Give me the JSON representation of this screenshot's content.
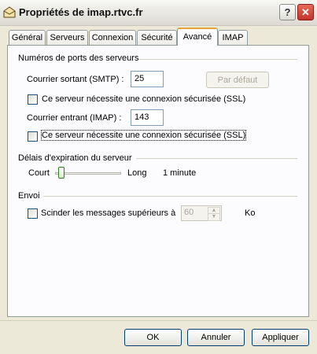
{
  "window": {
    "title": "Propriétés de imap.rtvc.fr",
    "icon": "mail-server-icon"
  },
  "title_buttons": {
    "help": "?",
    "close": "✕"
  },
  "tabs": [
    {
      "label": "Général",
      "active": false
    },
    {
      "label": "Serveurs",
      "active": false
    },
    {
      "label": "Connexion",
      "active": false
    },
    {
      "label": "Sécurité",
      "active": false
    },
    {
      "label": "Avancé",
      "active": true
    },
    {
      "label": "IMAP",
      "active": false
    }
  ],
  "ports": {
    "group_label": "Numéros de ports des serveurs",
    "smtp_label": "Courrier sortant (SMTP) :",
    "smtp_value": "25",
    "default_button": "Par défaut",
    "smtp_ssl_label": "Ce serveur nécessite une connexion sécurisée (SSL)",
    "smtp_ssl_checked": false,
    "imap_label": "Courrier entrant (IMAP) :",
    "imap_value": "143",
    "imap_ssl_label": "Ce serveur nécessite une connexion sécurisée (SSL)",
    "imap_ssl_checked": false
  },
  "timeout": {
    "group_label": "Délais d'expiration du serveur",
    "short_label": "Court",
    "long_label": "Long",
    "value_text": "1 minute",
    "slider_fraction": 0.05
  },
  "envoi": {
    "group_label": "Envoi",
    "split_label": "Scinder les messages supérieurs à",
    "split_checked": false,
    "size_value": "60",
    "unit": "Ko"
  },
  "footer": {
    "ok": "OK",
    "cancel": "Annuler",
    "apply": "Appliquer"
  }
}
